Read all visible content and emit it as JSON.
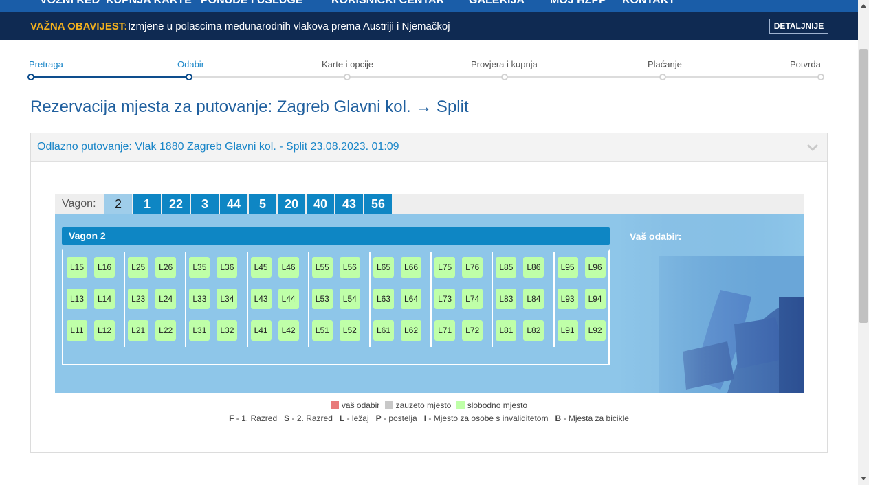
{
  "topnav": [
    "VOZNI RED",
    "KUPNJA KARTE",
    "PONUDE I USLUGE",
    "KORISNIČKI CENTAR",
    "GALERIJA",
    "MOJ HŽPP",
    "KONTAKT"
  ],
  "notice": {
    "label": "VAŽNA OBAVIJEST:",
    "text": "Izmjene u polascima međunarodnih vlakova prema Austriji i Njemačkoj",
    "button": "DETALJNIJE"
  },
  "steps": [
    {
      "label": "Pretraga",
      "state": "done"
    },
    {
      "label": "Odabir",
      "state": "current"
    },
    {
      "label": "Karte i opcije",
      "state": "todo"
    },
    {
      "label": "Provjera i kupnja",
      "state": "todo"
    },
    {
      "label": "Plaćanje",
      "state": "todo"
    },
    {
      "label": "Potvrda",
      "state": "todo"
    }
  ],
  "page_title": "Rezervacija mjesta za putovanje: Zagreb Glavni kol. → Split",
  "journey_header": "Odlazno putovanje: Vlak 1880 Zagreb Glavni kol. - Split 23.08.2023. 01:09",
  "wagon_label": "Vagon:",
  "wagons": [
    "2",
    "1",
    "22",
    "3",
    "44",
    "5",
    "20",
    "40",
    "43",
    "56"
  ],
  "active_wagon": "2",
  "wagon_title": "Vagon 2",
  "selection_label": "Vaš odabir:",
  "compartments": [
    [
      "L15",
      "L16",
      "L13",
      "L14",
      "L11",
      "L12"
    ],
    [
      "L25",
      "L26",
      "L23",
      "L24",
      "L21",
      "L22"
    ],
    [
      "L35",
      "L36",
      "L33",
      "L34",
      "L31",
      "L32"
    ],
    [
      "L45",
      "L46",
      "L43",
      "L44",
      "L41",
      "L42"
    ],
    [
      "L55",
      "L56",
      "L53",
      "L54",
      "L51",
      "L52"
    ],
    [
      "L65",
      "L66",
      "L63",
      "L64",
      "L61",
      "L62"
    ],
    [
      "L75",
      "L76",
      "L73",
      "L74",
      "L71",
      "L72"
    ],
    [
      "L85",
      "L86",
      "L83",
      "L84",
      "L81",
      "L82"
    ],
    [
      "L95",
      "L96",
      "L93",
      "L94",
      "L91",
      "L92"
    ]
  ],
  "seat_status": "free",
  "legend": [
    {
      "label": "vaš odabir",
      "color": "#e87a7a"
    },
    {
      "label": "zauzeto mjesto",
      "color": "#c8c8c8"
    },
    {
      "label": "slobodno mjesto",
      "color": "#bfffa8"
    }
  ],
  "abbreviations": [
    {
      "code": "F",
      "text": "- 1. Razred"
    },
    {
      "code": "S",
      "text": "- 2. Razred"
    },
    {
      "code": "L",
      "text": "- ležaj"
    },
    {
      "code": "P",
      "text": "- postelja"
    },
    {
      "code": "I",
      "text": "- Mjesto za osobe s invaliditetom"
    },
    {
      "code": "B",
      "text": "- Mjesta za bicikle"
    }
  ],
  "colors": {
    "brand": "#1a5da8",
    "notice_bg": "#0f2a52",
    "accent": "#0e86c4",
    "seat_free": "#bfffa8"
  }
}
